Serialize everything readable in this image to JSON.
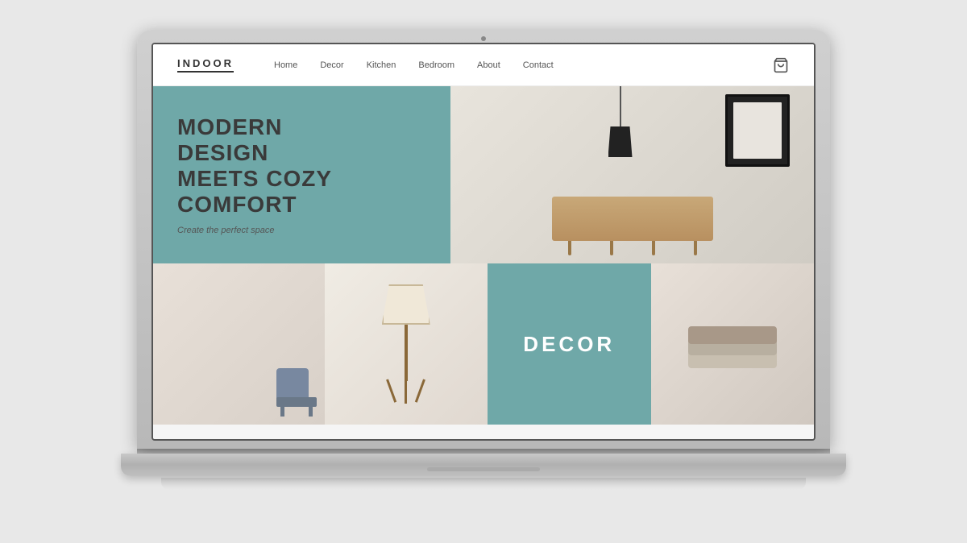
{
  "laptop": {
    "camera_label": "camera"
  },
  "site": {
    "navbar": {
      "logo": "INDOOR",
      "links": [
        {
          "label": "Home",
          "id": "home"
        },
        {
          "label": "Decor",
          "id": "decor"
        },
        {
          "label": "Kitchen",
          "id": "kitchen"
        },
        {
          "label": "Bedroom",
          "id": "bedroom"
        },
        {
          "label": "About",
          "id": "about"
        },
        {
          "label": "Contact",
          "id": "contact"
        }
      ],
      "cart_label": "🛍"
    },
    "hero": {
      "headline_line1": "MODERN",
      "headline_line2": "DESIGN",
      "headline_line3": "MEETS COZY",
      "headline_line4": "COMFORT",
      "subtext": "Create the perfect space"
    },
    "grid": {
      "decor_label": "DECOR"
    }
  }
}
